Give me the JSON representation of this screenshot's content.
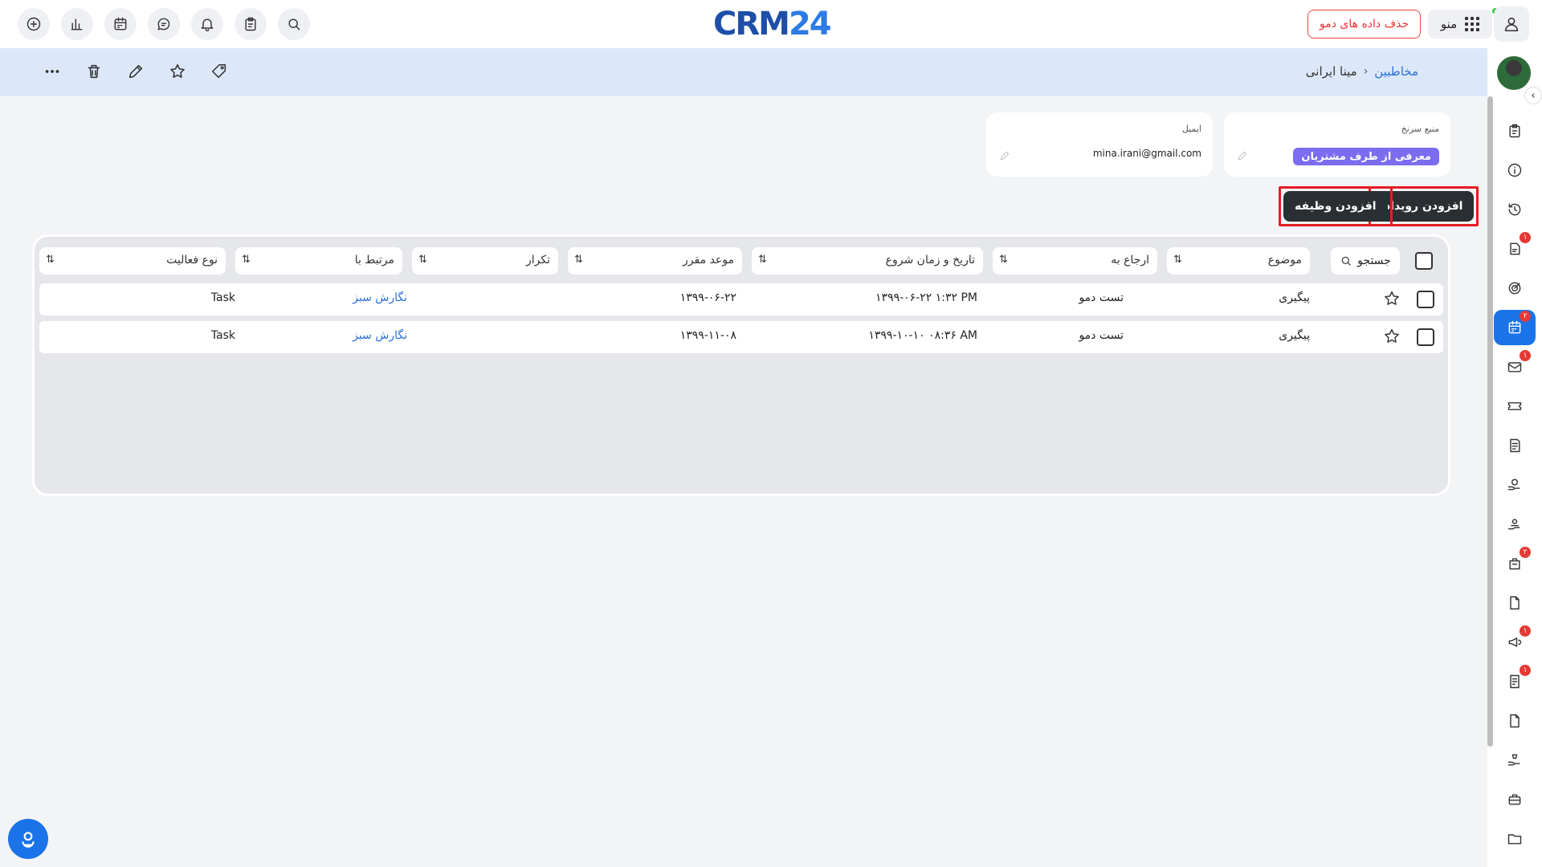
{
  "header": {
    "logo_crm": "CRM",
    "logo_num": "24",
    "demo_button": "حذف داده های دمو",
    "menu_label": "منو"
  },
  "breadcrumb": {
    "parent": "مخاطبین",
    "separator": "›",
    "current": "مینا ایرانی"
  },
  "fields": {
    "source": {
      "label": "منبع سرنخ",
      "value": "معرفی از طرف مشتریان"
    },
    "email": {
      "label": "ایمیل",
      "value": "mina.irani@gmail.com"
    }
  },
  "actions": {
    "add_event": "افزودن رویداد",
    "add_task": "افزودن وظیفه"
  },
  "table": {
    "search_label": "جستجو",
    "sort_glyph": "⇅",
    "columns": {
      "subject": "موضوع",
      "assigned": "ارجاع به",
      "start": "تاریخ و زمان شروع",
      "due": "موعد مقرر",
      "repeat": "تکرار",
      "related": "مرتبط با",
      "type": "نوع فعالیت"
    },
    "rows": [
      {
        "subject": "پیگیری",
        "assigned": "تست دمو",
        "start": "۱۳۹۹-۰۶-۲۲ ۱:۳۲ PM",
        "due": "۱۳۹۹-۰۶-۲۲",
        "repeat": "",
        "related": "نگارش سبز",
        "type": "Task"
      },
      {
        "subject": "پیگیری",
        "assigned": "تست دمو",
        "start": "۱۳۹۹-۱۰-۱۰ ۰۸:۳۶ AM",
        "due": "۱۳۹۹-۱۱-۰۸",
        "repeat": "",
        "related": "نگارش سبز",
        "type": "Task"
      }
    ]
  },
  "rail": {
    "badges": {
      "events": "۲",
      "tasks": "۱",
      "mail": "۱",
      "quotes": "۲",
      "campaigns": "۱",
      "invoices": "۱"
    }
  },
  "icons": [
    "plus-circle-icon",
    "chart-icon",
    "calendar-icon",
    "chat-icon",
    "bell-icon",
    "clipboard-icon",
    "search-icon",
    "user-icon",
    "tag-icon",
    "star-icon",
    "pencil-icon",
    "trash-icon",
    "more-icon",
    "help-icon"
  ],
  "colors": {
    "primary": "#1a73e8",
    "danger": "#e51c23",
    "chip": "#7c6cf0",
    "link": "#2c6fd6"
  }
}
